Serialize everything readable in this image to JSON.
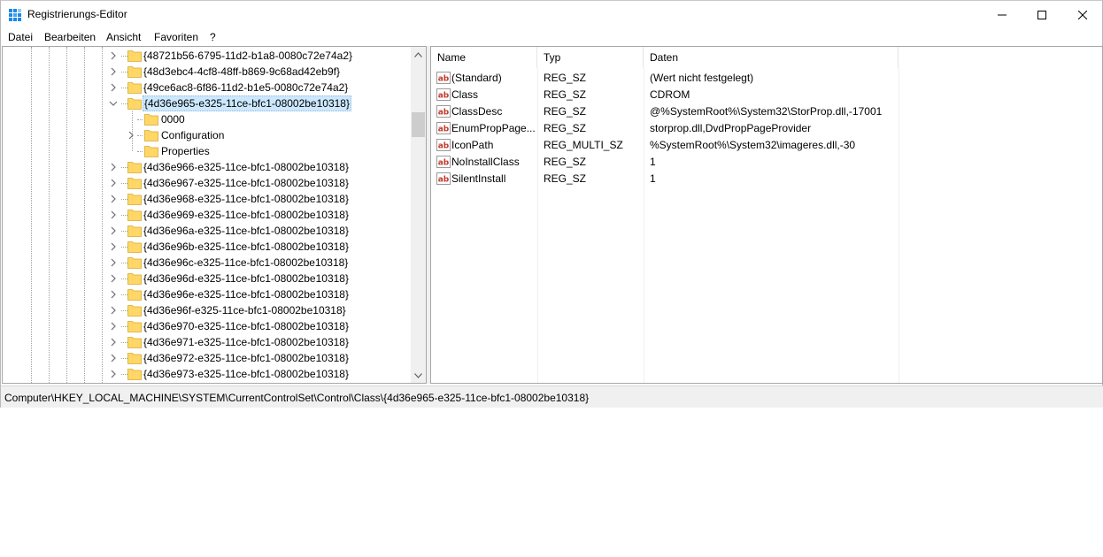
{
  "window": {
    "title": "Registrierungs-Editor",
    "controls": {
      "minimize_icon": "minimize-icon",
      "maximize_icon": "maximize-icon",
      "close_icon": "close-icon"
    }
  },
  "menu": [
    "Datei",
    "Bearbeiten",
    "Ansicht",
    "Favoriten",
    "?"
  ],
  "tree": {
    "items": [
      {
        "label": "{48721b56-6795-11d2-b1a8-0080c72e74a2}",
        "level": 0,
        "state": "collapsed"
      },
      {
        "label": "{48d3ebc4-4cf8-48ff-b869-9c68ad42eb9f}",
        "level": 0,
        "state": "collapsed"
      },
      {
        "label": "{49ce6ac8-6f86-11d2-b1e5-0080c72e74a2}",
        "level": 0,
        "state": "collapsed"
      },
      {
        "label": "{4d36e965-e325-11ce-bfc1-08002be10318}",
        "level": 0,
        "state": "expanded",
        "selected": true
      },
      {
        "label": "0000",
        "level": 1,
        "state": "leaf"
      },
      {
        "label": "Configuration",
        "level": 1,
        "state": "collapsed"
      },
      {
        "label": "Properties",
        "level": 1,
        "state": "leaf"
      },
      {
        "label": "{4d36e966-e325-11ce-bfc1-08002be10318}",
        "level": 0,
        "state": "collapsed"
      },
      {
        "label": "{4d36e967-e325-11ce-bfc1-08002be10318}",
        "level": 0,
        "state": "collapsed"
      },
      {
        "label": "{4d36e968-e325-11ce-bfc1-08002be10318}",
        "level": 0,
        "state": "collapsed"
      },
      {
        "label": "{4d36e969-e325-11ce-bfc1-08002be10318}",
        "level": 0,
        "state": "collapsed"
      },
      {
        "label": "{4d36e96a-e325-11ce-bfc1-08002be10318}",
        "level": 0,
        "state": "collapsed"
      },
      {
        "label": "{4d36e96b-e325-11ce-bfc1-08002be10318}",
        "level": 0,
        "state": "collapsed"
      },
      {
        "label": "{4d36e96c-e325-11ce-bfc1-08002be10318}",
        "level": 0,
        "state": "collapsed"
      },
      {
        "label": "{4d36e96d-e325-11ce-bfc1-08002be10318}",
        "level": 0,
        "state": "collapsed"
      },
      {
        "label": "{4d36e96e-e325-11ce-bfc1-08002be10318}",
        "level": 0,
        "state": "collapsed"
      },
      {
        "label": "{4d36e96f-e325-11ce-bfc1-08002be10318}",
        "level": 0,
        "state": "collapsed"
      },
      {
        "label": "{4d36e970-e325-11ce-bfc1-08002be10318}",
        "level": 0,
        "state": "collapsed"
      },
      {
        "label": "{4d36e971-e325-11ce-bfc1-08002be10318}",
        "level": 0,
        "state": "collapsed"
      },
      {
        "label": "{4d36e972-e325-11ce-bfc1-08002be10318}",
        "level": 0,
        "state": "collapsed"
      },
      {
        "label": "{4d36e973-e325-11ce-bfc1-08002be10318}",
        "level": 0,
        "state": "collapsed"
      }
    ]
  },
  "values": {
    "columns": {
      "name": "Name",
      "type": "Typ",
      "data": "Daten"
    },
    "rows": [
      {
        "name": "(Standard)",
        "type": "REG_SZ",
        "data": "(Wert nicht festgelegt)"
      },
      {
        "name": "Class",
        "type": "REG_SZ",
        "data": "CDROM"
      },
      {
        "name": "ClassDesc",
        "type": "REG_SZ",
        "data": "@%SystemRoot%\\System32\\StorProp.dll,-17001"
      },
      {
        "name": "EnumPropPage...",
        "type": "REG_SZ",
        "data": "storprop.dll,DvdPropPageProvider"
      },
      {
        "name": "IconPath",
        "type": "REG_MULTI_SZ",
        "data": "%SystemRoot%\\System32\\imageres.dll,-30"
      },
      {
        "name": "NoInstallClass",
        "type": "REG_SZ",
        "data": "1"
      },
      {
        "name": "SilentInstall",
        "type": "REG_SZ",
        "data": "1"
      }
    ]
  },
  "status": {
    "path": "Computer\\HKEY_LOCAL_MACHINE\\SYSTEM\\CurrentControlSet\\Control\\Class\\{4d36e965-e325-11ce-bfc1-08002be10318}"
  },
  "colors": {
    "folder": "#ffd766",
    "folder_edge": "#d9a92e",
    "selection": "#cce8ff",
    "string_icon": "#c0392b"
  }
}
